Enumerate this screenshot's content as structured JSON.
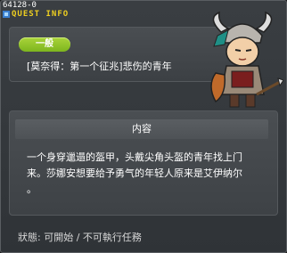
{
  "window": {
    "id_text": "64128-0",
    "title": "QUEST INFO"
  },
  "quest": {
    "category": "一般",
    "name": "[莫奈得：第一个征兆]悲伤的青年"
  },
  "content": {
    "heading": "内容",
    "lines": [
      "一个身穿邋遢的盔甲，头戴尖角头盔的青年找上门",
      "来。莎娜安想要给予勇气的年轻人原来是艾伊纳尔",
      "。"
    ]
  },
  "status": {
    "text": "狀態:  可開始  /  不可執行任務"
  },
  "colors": {
    "title_yellow": "#f0d020",
    "badge_green": "#8cc42a",
    "panel_bg": "#3a3e42"
  },
  "icons": [
    "quest-icon",
    "npc-avatar"
  ]
}
